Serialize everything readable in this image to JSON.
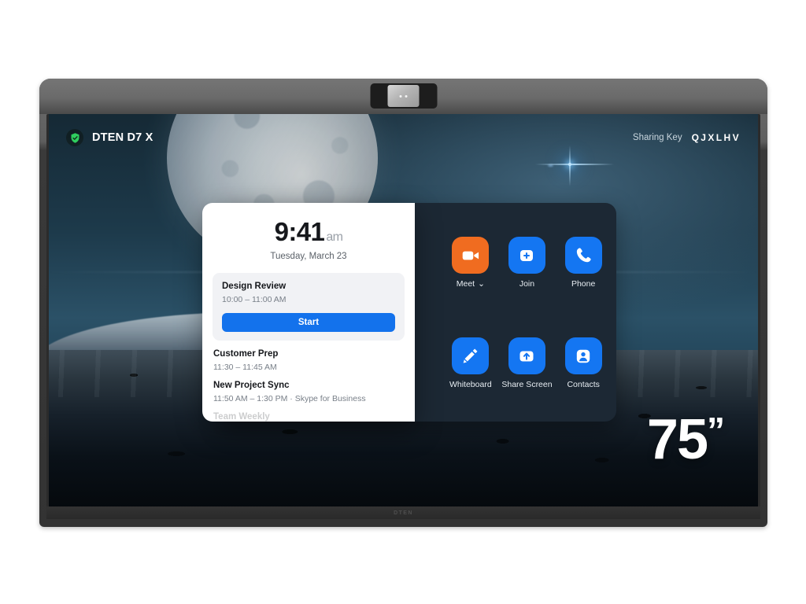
{
  "device": {
    "chin_logo": "DTEN",
    "camera_icon": "camera-module"
  },
  "screen": {
    "status": {
      "shield_icon": "shield-check-icon",
      "device_name": "DTEN D7 X",
      "sharing_label": "Sharing Key",
      "sharing_code": "QJXLHV"
    },
    "clock": {
      "time": "9:41",
      "suffix": "am",
      "date": "Tuesday, March 23"
    },
    "meetings": [
      {
        "title": "Design Review",
        "time": "10:00 – 11:00 AM",
        "action_label": "Start",
        "current": true
      },
      {
        "title": "Customer Prep",
        "time": "11:30 – 11:45 AM",
        "current": false
      },
      {
        "title": "New Project Sync",
        "time": "11:50 AM – 1:30 PM · Skype for Business",
        "current": false
      },
      {
        "title": "Team Weekly",
        "time": "",
        "current": false
      }
    ],
    "actions": [
      {
        "label": "Meet",
        "icon": "video-camera-icon",
        "color": "#f06c20",
        "has_chevron": true,
        "chevron": "⌄"
      },
      {
        "label": "Join",
        "icon": "plus-square-icon",
        "color": "#1476f2",
        "has_chevron": false
      },
      {
        "label": "Phone",
        "icon": "phone-handset-icon",
        "color": "#1476f2",
        "has_chevron": false
      },
      {
        "label": "Whiteboard",
        "icon": "pencil-icon",
        "color": "#1476f2",
        "has_chevron": false
      },
      {
        "label": "Share Screen",
        "icon": "share-upload-icon",
        "color": "#1476f2",
        "has_chevron": false
      },
      {
        "label": "Contacts",
        "icon": "person-icon",
        "color": "#1476f2",
        "has_chevron": false
      }
    ],
    "size_mark": {
      "number": "75",
      "quote": "”"
    }
  },
  "colors": {
    "accent_blue": "#1372ec",
    "tile_blue": "#1476f2",
    "tile_orange": "#f06c20",
    "panel_dark": "#1c2834",
    "card_white": "#ffffff",
    "shield_green": "#2fce5e"
  }
}
